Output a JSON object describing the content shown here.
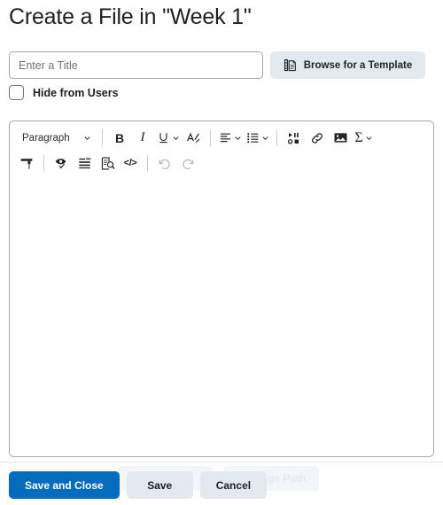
{
  "page": {
    "title": "Create a File in \"Week 1\""
  },
  "title_row": {
    "input_placeholder": "Enter a Title",
    "input_value": "",
    "browse_label": "Browse for a Template",
    "browse_icon": "template-document-icon"
  },
  "hide_row": {
    "checkbox_checked": false,
    "label": "Hide from Users"
  },
  "editor": {
    "body_text": "",
    "toolbar": {
      "row1": [
        {
          "name": "paragraph-style-select",
          "label": "Paragraph",
          "caret": true,
          "type": "select"
        },
        {
          "name": "separator-1",
          "type": "separator"
        },
        {
          "name": "bold-button",
          "glyph": "B",
          "type": "glyph-bold"
        },
        {
          "name": "italic-button",
          "glyph": "I",
          "type": "glyph-italic"
        },
        {
          "name": "underline-button",
          "glyph": "U",
          "type": "icon-underline",
          "caret": true
        },
        {
          "name": "text-color-button",
          "glyph": "A",
          "type": "icon-text-color"
        },
        {
          "name": "separator-2",
          "type": "separator"
        },
        {
          "name": "align-button",
          "type": "icon-align",
          "caret": true
        },
        {
          "name": "list-button",
          "type": "icon-list",
          "caret": true
        },
        {
          "name": "separator-3",
          "type": "separator"
        },
        {
          "name": "insert-media-button",
          "type": "icon-media"
        },
        {
          "name": "insert-link-button",
          "type": "icon-link"
        },
        {
          "name": "insert-image-button",
          "type": "icon-image"
        },
        {
          "name": "insert-equation-button",
          "glyph": "Σ",
          "type": "icon-equation",
          "caret": true
        }
      ],
      "row2": [
        {
          "name": "format-painter-button",
          "type": "icon-format-painter"
        },
        {
          "name": "separator-4",
          "type": "separator"
        },
        {
          "name": "accessibility-checker-button",
          "type": "icon-accessibility-check"
        },
        {
          "name": "word-count-button",
          "type": "icon-word-count"
        },
        {
          "name": "preview-button",
          "type": "icon-preview"
        },
        {
          "name": "html-source-button",
          "glyph": "</>",
          "type": "icon-html-source"
        },
        {
          "name": "separator-5",
          "type": "separator"
        },
        {
          "name": "undo-button",
          "type": "icon-undo",
          "disabled": true
        },
        {
          "name": "redo-button",
          "type": "icon-redo",
          "disabled": true
        }
      ]
    }
  },
  "footer": {
    "save_and_close_label": "Save and Close",
    "save_label": "Save",
    "cancel_label": "Cancel",
    "ghost_change_path_label": "Change Path"
  },
  "colors": {
    "primary_blue": "#046bbf",
    "secondary_gray": "#e3e9ef",
    "border_gray": "#a5a9af",
    "text": "#1f1f1f",
    "ghost_text": "#e6eaf0"
  }
}
